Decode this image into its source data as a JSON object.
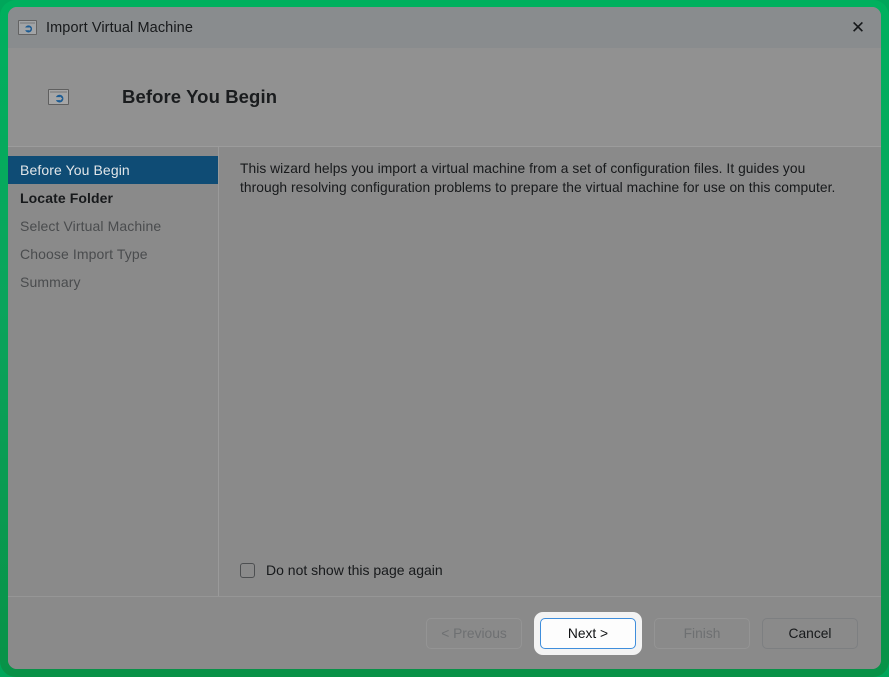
{
  "window": {
    "title": "Import Virtual Machine",
    "title_icon": "import-vm-icon",
    "close_icon": "✕"
  },
  "header": {
    "icon": "import-vm-icon",
    "title": "Before You Begin"
  },
  "sidebar": {
    "items": [
      {
        "label": "Before You Begin",
        "state": "selected"
      },
      {
        "label": "Locate Folder",
        "state": "upcoming"
      },
      {
        "label": "Select Virtual Machine",
        "state": "pending"
      },
      {
        "label": "Choose Import Type",
        "state": "pending"
      },
      {
        "label": "Summary",
        "state": "pending"
      }
    ]
  },
  "content": {
    "description": "This wizard helps you import a virtual machine from a set of configuration files. It guides you through resolving configuration problems to prepare the virtual machine for use on this computer.",
    "checkbox": {
      "label": "Do not show this page again",
      "checked": false
    }
  },
  "footer": {
    "buttons": [
      {
        "label": "< Previous",
        "state": "disabled"
      },
      {
        "label": "Next >",
        "state": "default-focused"
      },
      {
        "label": "Finish",
        "state": "disabled"
      },
      {
        "label": "Cancel",
        "state": "enabled"
      }
    ]
  },
  "colors": {
    "recording_border": "#00a65a",
    "window_background": "#8a8a8a",
    "titlebar": "#898c8e",
    "header_band": "#919191",
    "selected_nav": "#0f4c75",
    "focus_border": "#3f8edc",
    "icon_arrow": "#1d5c93"
  }
}
